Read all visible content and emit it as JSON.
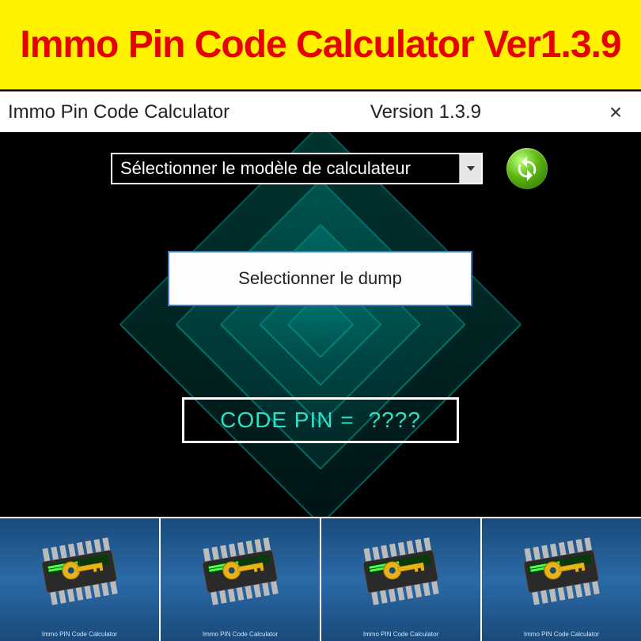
{
  "banner": {
    "title": "Immo Pin Code Calculator Ver1.3.9"
  },
  "titlebar": {
    "title": "Immo Pin Code Calculator",
    "version": "Version 1.3.9",
    "close": "×"
  },
  "dropdown": {
    "label": "Sélectionner le modèle de calculateur"
  },
  "dump_button": {
    "label": "Selectionner le dump"
  },
  "result": {
    "label": "CODE PIN =",
    "value": "????"
  },
  "thumbs": {
    "items": [
      {
        "label": "Immo PIN Code Calculator"
      },
      {
        "label": "Immo PIN Code Calculator"
      },
      {
        "label": "Immo PIN Code Calculator"
      },
      {
        "label": "Immo PIN Code Calculator"
      }
    ]
  }
}
